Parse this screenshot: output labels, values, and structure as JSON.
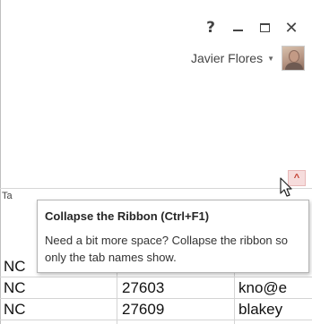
{
  "window": {
    "help_label": "?",
    "minimize_label": "minimize",
    "maximize_label": "maximize",
    "close_label": "✕"
  },
  "account": {
    "user_name": "Javier Flores",
    "caret": "▼"
  },
  "ribbon": {
    "tab_partial": "Ta",
    "collapse_button_glyph": "^"
  },
  "tooltip": {
    "title": "Collapse the Ribbon (Ctrl+F1)",
    "description": "Need a bit more space? Collapse the ribbon so only the tab names show."
  },
  "grid": {
    "rows": [
      [
        "NC",
        "",
        ""
      ],
      [
        "NC",
        "27603",
        "kno@e"
      ],
      [
        "NC",
        "27609",
        "blakey"
      ]
    ]
  },
  "colors": {
    "collapse_button_bg": "#f6dcdc",
    "collapse_button_glyph": "#c0392b"
  }
}
